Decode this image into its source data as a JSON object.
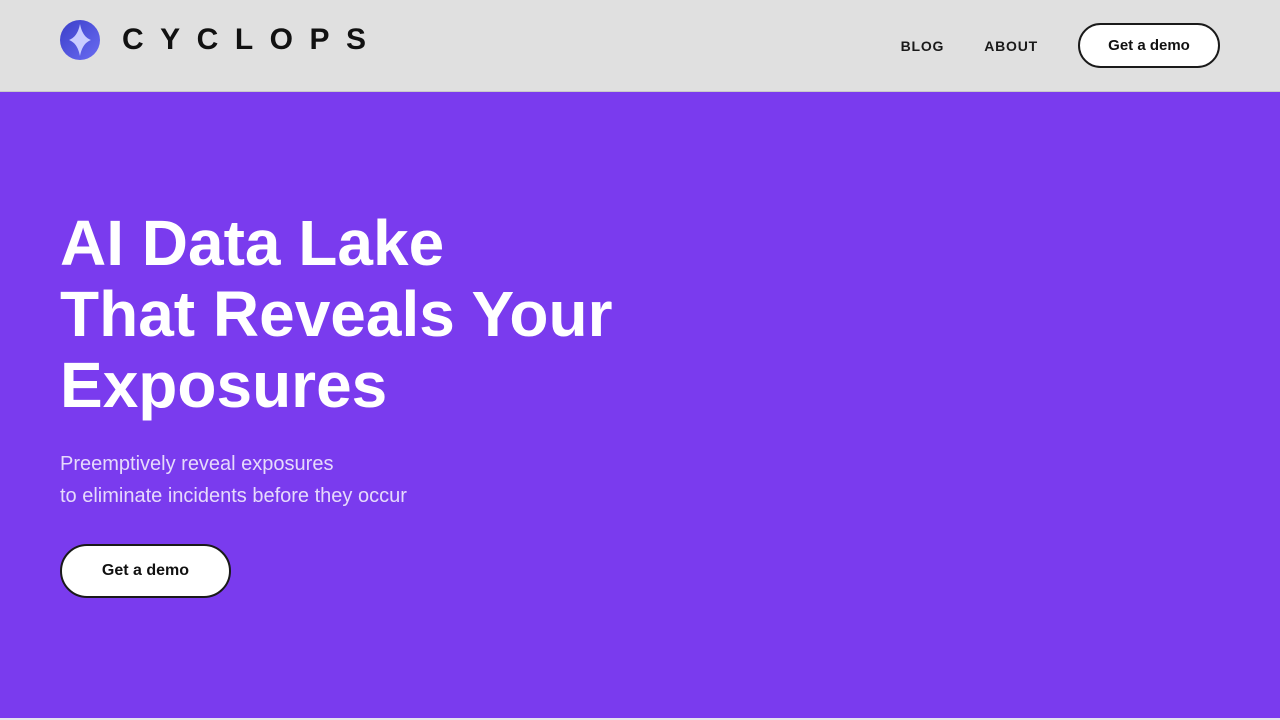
{
  "brand": {
    "name": "CYCLOPS",
    "logo_icon": "cyclops-eye-logo-icon",
    "logo_colors": [
      "#4f46e5",
      "#6366f1",
      "#c7d2fe"
    ]
  },
  "nav": {
    "links": [
      {
        "label": "BLOG"
      },
      {
        "label": "ABOUT"
      }
    ],
    "cta_label": "Get a demo"
  },
  "hero": {
    "title_lines": [
      "AI Data Lake",
      "That Reveals Your",
      "Exposures"
    ],
    "subtitle_lines": [
      "Preemptively reveal exposures",
      "to eliminate incidents before they occur"
    ],
    "cta_label": "Get a demo"
  },
  "colors": {
    "header_bg": "#e0e0e0",
    "hero_bg": "#7a3bee",
    "text_dark": "#111111",
    "text_light": "#ffffff"
  }
}
